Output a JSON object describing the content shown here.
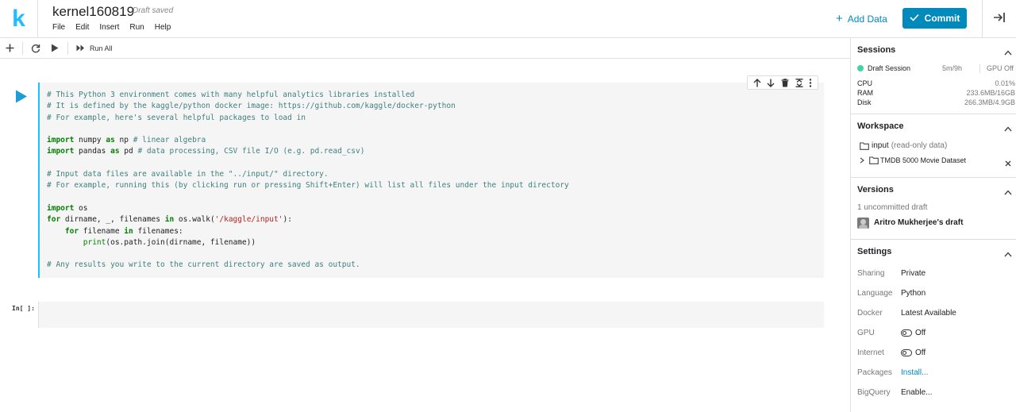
{
  "header": {
    "logo": "k",
    "title": "kernel160819",
    "status": "Draft saved",
    "menu": [
      "File",
      "Edit",
      "Insert",
      "Run",
      "Help"
    ],
    "add_data": "Add Data",
    "commit": "Commit"
  },
  "toolbar": {
    "run_all": "Run All"
  },
  "cell1": {
    "lines": [
      [
        [
          "cm",
          "# This Python 3 environment comes with many helpful analytics libraries installed"
        ]
      ],
      [
        [
          "cm",
          "# It is defined by the kaggle/python docker image: https://github.com/kaggle/docker-python"
        ]
      ],
      [
        [
          "cm",
          "# For example, here's several helpful packages to load in"
        ]
      ],
      [],
      [
        [
          "kw",
          "import"
        ],
        [
          "",
          " numpy "
        ],
        [
          "kw",
          "as"
        ],
        [
          "",
          " np "
        ],
        [
          "cm",
          "# linear algebra"
        ]
      ],
      [
        [
          "kw",
          "import"
        ],
        [
          "",
          " pandas "
        ],
        [
          "kw",
          "as"
        ],
        [
          "",
          " pd "
        ],
        [
          "cm",
          "# data processing, CSV file I/O (e.g. pd.read_csv)"
        ]
      ],
      [],
      [
        [
          "cm",
          "# Input data files are available in the \"../input/\" directory."
        ]
      ],
      [
        [
          "cm",
          "# For example, running this (by clicking run or pressing Shift+Enter) will list all files under the input directory"
        ]
      ],
      [],
      [
        [
          "kw",
          "import"
        ],
        [
          "",
          " os"
        ]
      ],
      [
        [
          "kw",
          "for"
        ],
        [
          "",
          " dirname, _, filenames "
        ],
        [
          "kw",
          "in"
        ],
        [
          "",
          " os.walk("
        ],
        [
          "st",
          "'/kaggle/input'"
        ],
        [
          "",
          "):"
        ]
      ],
      [
        [
          "",
          "    "
        ],
        [
          "kw",
          "for"
        ],
        [
          "",
          " filename "
        ],
        [
          "kw",
          "in"
        ],
        [
          "",
          " filenames:"
        ]
      ],
      [
        [
          "",
          "        "
        ],
        [
          "bi",
          "print"
        ],
        [
          "",
          "(os.path.join(dirname, filename))"
        ]
      ],
      [],
      [
        [
          "cm",
          "# Any results you write to the current directory are saved as output."
        ]
      ]
    ]
  },
  "cell2": {
    "prompt": "In[ ]:"
  },
  "sidebar": {
    "sessions": {
      "title": "Sessions",
      "session_name": "Draft Session",
      "session_time": "5m/9h",
      "gpu_status": "GPU Off",
      "status_color": "#3ed4a5",
      "metrics": [
        {
          "label": "CPU",
          "value": "0.01%"
        },
        {
          "label": "RAM",
          "value": "233.6MB/16GB"
        },
        {
          "label": "Disk",
          "value": "266.3MB/4.9GB"
        }
      ]
    },
    "workspace": {
      "title": "Workspace",
      "input_label": "input",
      "input_note": "(read-only data)",
      "dataset": "TMDB 5000 Movie Dataset"
    },
    "versions": {
      "title": "Versions",
      "uncommitted": "1 uncommitted draft",
      "draft_owner": "Aritro Mukherjee's draft"
    },
    "settings": {
      "title": "Settings",
      "rows": [
        {
          "label": "Sharing",
          "value": "Private"
        },
        {
          "label": "Language",
          "value": "Python"
        },
        {
          "label": "Docker",
          "value": "Latest Available"
        },
        {
          "label": "GPU",
          "value": "Off"
        },
        {
          "label": "Internet",
          "value": "Off"
        },
        {
          "label": "Packages",
          "value": "Install..."
        },
        {
          "label": "BigQuery",
          "value": "Enable..."
        }
      ]
    }
  },
  "colors": {
    "accent": "#20beff",
    "primary": "#008abc"
  }
}
